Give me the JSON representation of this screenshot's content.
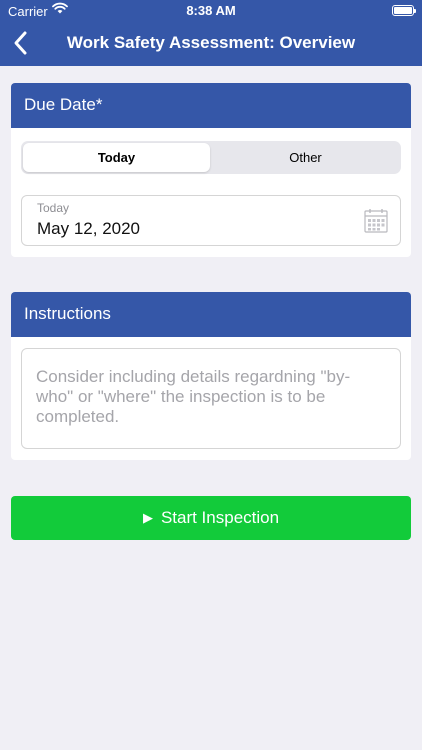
{
  "status_bar": {
    "carrier": "Carrier",
    "time": "8:38 AM"
  },
  "nav": {
    "title": "Work Safety Assessment: Overview",
    "back_icon": "chevron-left-icon"
  },
  "due_date": {
    "header": "Due Date*",
    "options": [
      "Today",
      "Other"
    ],
    "selected": "Today",
    "field_label": "Today",
    "field_value": "May 12, 2020",
    "icon": "calendar-icon"
  },
  "instructions": {
    "header": "Instructions",
    "placeholder": "Consider including details regardning \"by-who\" or \"where\" the inspection is to be completed."
  },
  "actions": {
    "start_label": "Start Inspection",
    "start_icon": "play-icon"
  },
  "colors": {
    "brand_blue": "#3557a8",
    "start_green": "#12cb3a",
    "background": "#f0eff5"
  }
}
